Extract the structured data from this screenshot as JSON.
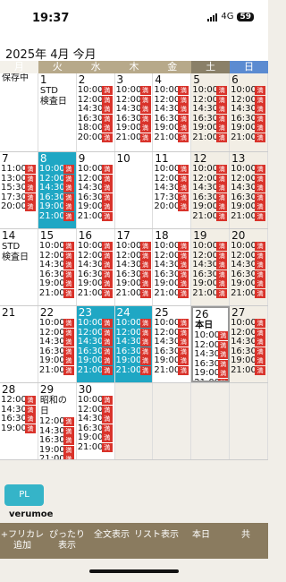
{
  "status": {
    "time": "19:37",
    "network": "4G",
    "battery": "59"
  },
  "header": {
    "title": "2025年 4月 今月"
  },
  "weekdays": [
    "月",
    "火",
    "水",
    "木",
    "金",
    "土",
    "日"
  ],
  "labels": {
    "save": "保存中",
    "pl": "PL",
    "logo": "verumoe",
    "today": "本日"
  },
  "toolbar": [
    "+フリカレ 追加",
    "ぴったり 表示",
    "全文表示",
    "リスト表示",
    "本日",
    "共"
  ],
  "marks": {
    "full": "満",
    "free": "空室"
  },
  "weeks": [
    [
      {
        "d": "",
        "blank": true,
        "tag": "保存中"
      },
      {
        "d": "1",
        "tag": "STD\n検査日"
      },
      {
        "d": "2",
        "s": [
          "10:00",
          "12:00",
          "14:30",
          "16:30",
          "18:00",
          "20:00"
        ]
      },
      {
        "d": "3",
        "s": [
          "10:00",
          "12:00",
          "14:30",
          "16:30",
          "19:00",
          "21:00"
        ]
      },
      {
        "d": "4",
        "s": [
          "10:00",
          "12:00",
          "14:30",
          "16:30",
          "19:00",
          "21:00"
        ]
      },
      {
        "d": "5",
        "we": 1,
        "s": [
          "10:00",
          "12:00",
          "14:30",
          "16:30",
          "19:00",
          "21:00"
        ]
      },
      {
        "d": "6",
        "we": 1,
        "s": [
          "10:00",
          "12:00",
          "14:30",
          "16:30",
          "19:00",
          "21:00"
        ]
      }
    ],
    [
      {
        "d": "7",
        "s": [
          "11:00",
          "13:00",
          "15:30",
          "17:30",
          "20:00"
        ]
      },
      {
        "d": "8",
        "hl": 1,
        "s": [
          "10:00",
          "12:00",
          "14:30",
          "16:30",
          "19:00",
          "21:00"
        ]
      },
      {
        "d": "9",
        "s": [
          "10:00",
          "12:00",
          "14:30",
          "16:30",
          "19:00",
          "21:00"
        ]
      },
      {
        "d": "10",
        "s": []
      },
      {
        "d": "11",
        "s": [
          "10:00",
          "12:00",
          "14:30",
          "17:30",
          "20:00"
        ]
      },
      {
        "d": "12",
        "we": 1,
        "s": [
          "10:00",
          "12:00",
          "14:30",
          "16:30",
          "19:00",
          "21:00"
        ]
      },
      {
        "d": "13",
        "we": 1,
        "s": [
          "10:00",
          "12:00",
          "14:30",
          "16:30",
          "19:00",
          "21:00"
        ]
      }
    ],
    [
      {
        "d": "14",
        "tag": "STD\n検査日"
      },
      {
        "d": "15",
        "s": [
          "10:00",
          "12:00",
          "14:30",
          "16:30",
          "19:00",
          "21:00"
        ]
      },
      {
        "d": "16",
        "s": [
          "10:00",
          "12:00",
          "14:30",
          "16:30",
          "19:00",
          "21:00"
        ]
      },
      {
        "d": "17",
        "s": [
          "10:00",
          "12:00",
          "14:30",
          "16:30",
          "19:00",
          "21:00"
        ]
      },
      {
        "d": "18",
        "s": [
          "10:00",
          "12:00",
          "14:30",
          "16:30",
          "19:00",
          "21:00"
        ]
      },
      {
        "d": "19",
        "we": 1,
        "s": [
          "10:00",
          "12:00",
          "14:30",
          "16:30",
          "19:00",
          "21:00"
        ]
      },
      {
        "d": "20",
        "we": 1,
        "s": [
          "10:00",
          "12:00",
          "14:30",
          "16:30",
          "19:00",
          "21:00"
        ]
      }
    ],
    [
      {
        "d": "21",
        "s": []
      },
      {
        "d": "22",
        "s": [
          "10:00",
          "12:00",
          "14:30",
          "16:30",
          "19:00",
          "21:00"
        ]
      },
      {
        "d": "23",
        "hl": 1,
        "s": [
          "10:00",
          "12:00",
          "14:30",
          "16:30",
          "19:00",
          "21:00"
        ]
      },
      {
        "d": "24",
        "hl": 1,
        "s": [
          "10:00",
          "12:00",
          "14:30",
          "16:30",
          "19:00",
          "21:00"
        ]
      },
      {
        "d": "25",
        "s": [
          "10:00",
          "12:00",
          "14:30",
          "16:30",
          "19:00",
          "21:00"
        ]
      },
      {
        "d": "26",
        "today": 1,
        "s": [
          "10:00",
          "12:00",
          "14:30",
          "16:30",
          "19:00",
          "21:00"
        ]
      },
      {
        "d": "27",
        "we": 1,
        "s": [
          "10:00",
          "12:00",
          "14:30",
          "16:30",
          "19:00",
          "21:00"
        ]
      }
    ],
    [
      {
        "d": "28",
        "s": [
          "12:00",
          "14:30",
          "16:30",
          "19:00"
        ]
      },
      {
        "d": "29",
        "tag": "昭和の日",
        "s": [
          "12:00",
          "14:30",
          "16:30",
          "19:00",
          "21:00",
          "21:00"
        ]
      },
      {
        "d": "30",
        "s": [
          "10:00",
          "12:00",
          "14:30",
          "16:30",
          "19:00",
          "21:00"
        ]
      },
      {
        "d": "",
        "blank": true
      },
      {
        "d": "",
        "blank": true
      },
      {
        "d": "",
        "blank": true
      },
      {
        "d": "",
        "blank": true
      }
    ]
  ]
}
